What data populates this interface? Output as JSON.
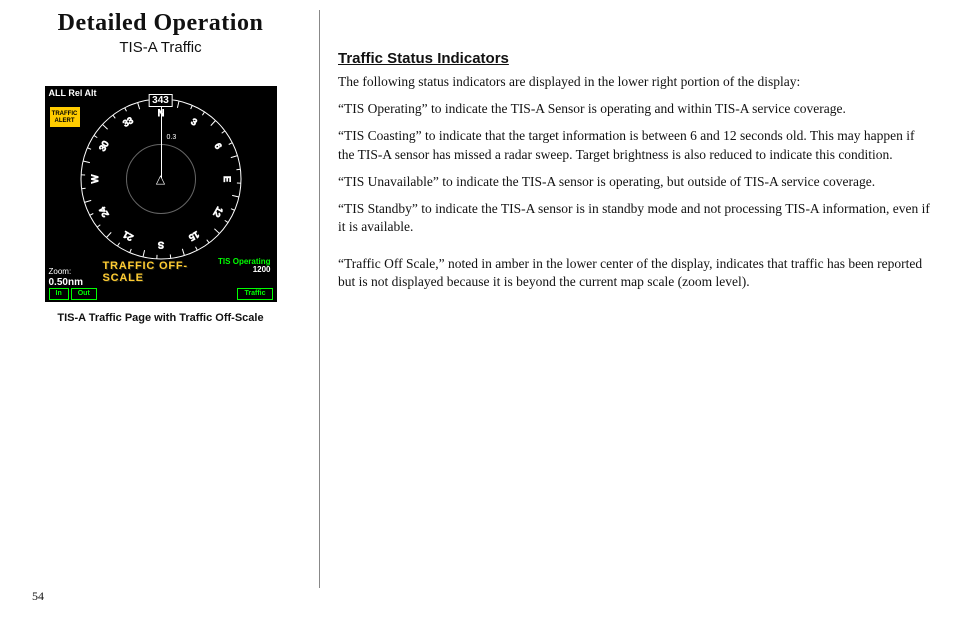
{
  "header": {
    "title": "Detailed Operation",
    "subtitle": "TIS-A Traffic"
  },
  "display": {
    "top_label": "ALL Rel Alt",
    "traffic_alert_line1": "TRAFFIC",
    "traffic_alert_line2": "ALERT",
    "heading": "343",
    "inner_range": "0.3",
    "tis_status": "TIS Operating",
    "altitude": "1200",
    "offscale": "TRAFFIC OFF-SCALE",
    "zoom_label": "Zoom:",
    "zoom_value": "0.50nm",
    "tab_in": "In",
    "tab_out": "Out",
    "tab_traffic": "Traffic"
  },
  "caption": "TIS-A Traffic Page with Traffic Off-Scale",
  "section_title": "Traffic Status Indicators",
  "paragraphs": {
    "p0": "The following status indicators are displayed in the lower right portion of the display:",
    "p1": "“TIS Operating” to indicate the TIS-A Sensor is operating and within TIS-A service coverage.",
    "p2": "“TIS Coasting” to indicate that the target information is between 6 and 12 seconds old. This may happen if the TIS-A sensor has missed a radar sweep. Target brightness is also reduced to indicate this condition.",
    "p3": "“TIS Unavailable” to indicate the TIS-A sensor is operating, but outside of TIS-A service coverage.",
    "p4": "“TIS Standby” to indicate the TIS-A sensor is in standby mode and not processing TIS-A information, even if it is available.",
    "p5": "“Traffic Off Scale,” noted in amber in the lower center of the display, indicates that traffic has been reported but is not displayed because it is beyond the current map scale (zoom level)."
  },
  "page_number": "54"
}
